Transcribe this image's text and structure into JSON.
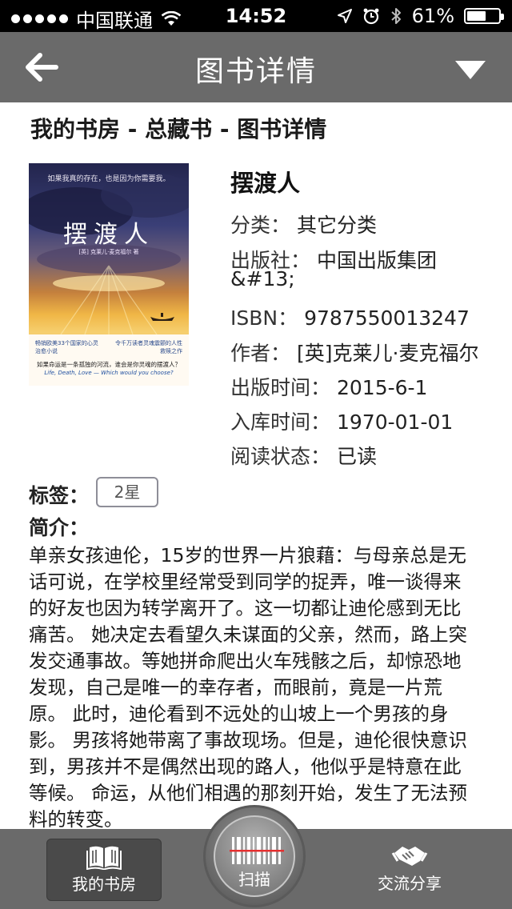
{
  "status_bar": {
    "carrier": "中国联通",
    "time": "14:52",
    "battery": "61%",
    "battery_level": 0.61
  },
  "nav": {
    "title": "图书详情",
    "back_icon": "arrow-left-icon",
    "menu_icon": "triangle-down-icon"
  },
  "breadcrumb": "我的书房 - 总藏书 - 图书详情",
  "cover": {
    "tagline": "如果我真的存在，也是因为你需要我。",
    "title": "摆渡人",
    "author_line": "[英] 克莱儿·麦克福尔  著",
    "blurb_left": "畅销欧美33个国家的心灵治愈小说",
    "blurb_right": "令千万读者灵魂震颤的人性救赎之作",
    "question": "如果命运是一条孤独的河流，谁会是你灵魂的摆渡人？",
    "question_en": "Life, Death, Love — Which would you choose?"
  },
  "book": {
    "title": "摆渡人",
    "category_label": "分类",
    "category": "其它分类",
    "publisher_label": "出版社",
    "publisher": "中国出版集团",
    "publisher_extra": "&#13;",
    "isbn_label": "ISBN",
    "isbn": "9787550013247",
    "author_label": "作者",
    "author": "[英]克莱儿·麦克福尔",
    "pubdate_label": "出版时间",
    "pubdate": "2015-6-1",
    "stored_label": "入库时间",
    "stored": "1970-01-01",
    "read_label": "阅读状态",
    "read": "已读",
    "separator": "："
  },
  "tags": {
    "label": "标签：",
    "chip": "2星"
  },
  "intro": {
    "label": "简介：",
    "text": "单亲女孩迪伦，15岁的世界一片狼藉：与母亲总是无话可说，在学校里经常受到同学的捉弄，唯一谈得来的好友也因为转学离开了。这一切都让迪伦感到无比痛苦。 她决定去看望久未谋面的父亲，然而，路上突发交通事故。等她拼命爬出火车残骸之后，却惊恐地发现，自己是唯一的幸存者，而眼前，竟是一片荒原。 此时，迪伦看到不远处的山坡上一个男孩的身影。 男孩将她带离了事故现场。但是，迪伦很快意识到，男孩并不是偶然出现的路人，他似乎是特意在此等候。 命运，从他们相遇的那刻开始，发生了无法预料的转变。"
  },
  "tab_bar": {
    "home_label": "我的书房",
    "home_icon": "open-book-icon",
    "scan_label": "扫描",
    "scan_icon": "barcode-scan-icon",
    "share_label": "交流分享",
    "share_icon": "handshake-icon"
  }
}
